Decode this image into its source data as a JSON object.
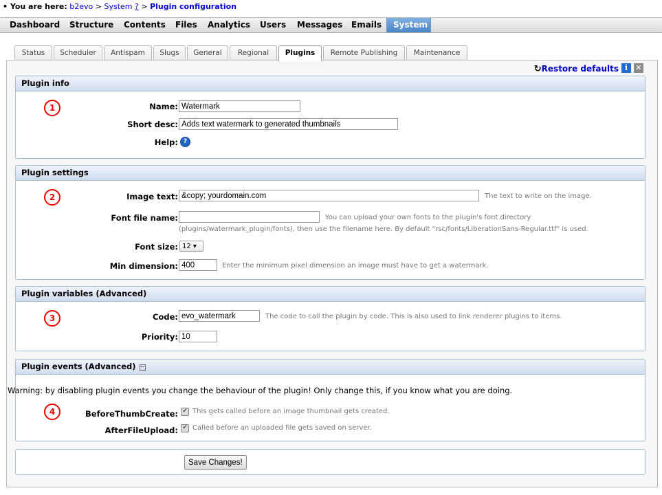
{
  "breadcrumb": {
    "prefix": "• You are here:",
    "items": [
      "b2evo",
      "System",
      "?",
      "Plugin configuration"
    ],
    "separator": ">"
  },
  "topmenu": [
    "Dashboard",
    "Structure",
    "Contents",
    "Files",
    "Analytics",
    "Users",
    "Messages",
    "Emails",
    "System"
  ],
  "tabs": [
    "Status",
    "Scheduler",
    "Antispam",
    "Slugs",
    "General",
    "Regional",
    "Plugins",
    "Remote Publishing",
    "Maintenance"
  ],
  "active_tab": "Plugins",
  "toolbar": {
    "restore_label": "Restore defaults",
    "info_glyph": "i",
    "close_glyph": "✕"
  },
  "plugin_info": {
    "title": "Plugin info",
    "marker": "1",
    "name_label": "Name:",
    "name_value": "Watermark",
    "short_desc_label": "Short desc:",
    "short_desc_value": "Adds text watermark to generated thumbnails",
    "help_label": "Help:"
  },
  "plugin_settings": {
    "title": "Plugin settings",
    "marker": "2",
    "image_text_label": "Image text:",
    "image_text_value": "&copy; yourdomain.com",
    "image_text_note": "The text to write on the image.",
    "font_file_label": "Font file name:",
    "font_file_value": "",
    "font_file_note1": "You can upload your own fonts to the plugin's font directory",
    "font_file_note2": "(plugins/watermark_plugin/fonts), then use the filename here. By default \"rsc/fonts/LiberationSans-Regular.ttf\" is used.",
    "font_size_label": "Font size:",
    "font_size_value": "12 ▾",
    "min_dim_label": "Min dimension:",
    "min_dim_value": "400",
    "min_dim_note": "Enter the minimum pixel dimension an image must have to get a watermark."
  },
  "plugin_variables": {
    "title": "Plugin variables (Advanced)",
    "marker": "3",
    "code_label": "Code:",
    "code_value": "evo_watermark",
    "code_note": "The code to call the plugin by code. This is also used to link renderer plugins to items.",
    "priority_label": "Priority:",
    "priority_value": "10"
  },
  "plugin_events": {
    "title": "Plugin events (Advanced)",
    "collapse_glyph": "−",
    "marker": "4",
    "warning": "Warning: by disabling plugin events you change the behaviour of the plugin! Only change this, if you know what you are doing.",
    "events": [
      {
        "label": "BeforeThumbCreate:",
        "note": "This gets called before an image thumbnail gets created."
      },
      {
        "label": "AfterFileUpload:",
        "note": "Called before an uploaded file gets saved on server."
      }
    ]
  },
  "save_label": "Save Changes!"
}
